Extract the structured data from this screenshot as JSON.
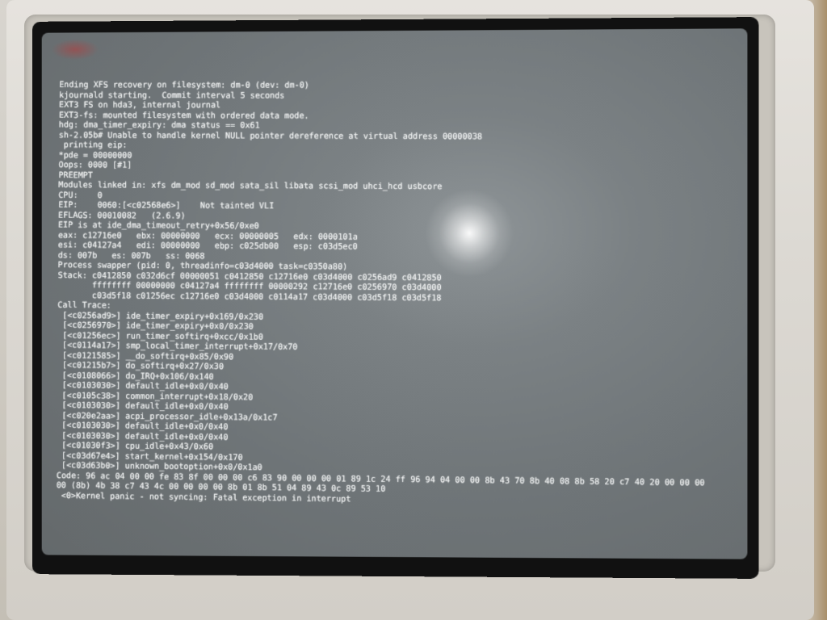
{
  "console": {
    "lines": [
      "Ending XFS recovery on filesystem: dm-0 (dev: dm-0)",
      "kjournald starting.  Commit interval 5 seconds",
      "EXT3 FS on hda3, internal journal",
      "EXT3-fs: mounted filesystem with ordered data mode.",
      "hdg: dma_timer_expiry: dma status == 0x61",
      "sh-2.05b# Unable to handle kernel NULL pointer dereference at virtual address 00000038",
      " printing eip:",
      "*pde = 00000000",
      "Oops: 0000 [#1]",
      "PREEMPT",
      "Modules linked in: xfs dm_mod sd_mod sata_sil libata scsi_mod uhci_hcd usbcore",
      "CPU:    0",
      "EIP:    0060:[<c02568e6>]    Not tainted VLI",
      "EFLAGS: 00010082   (2.6.9)",
      "EIP is at ide_dma_timeout_retry+0x56/0xe0",
      "eax: c12716e0   ebx: 00000000   ecx: 00000005   edx: 0000101a",
      "esi: c04127a4   edi: 00000000   ebp: c025db00   esp: c03d5ec0",
      "ds: 007b   es: 007b   ss: 0068",
      "Process swapper (pid: 0, threadinfo=c03d4000 task=c0350a80)",
      "Stack: c0412850 c032d6cf 00000051 c0412850 c12716e0 c03d4000 c0256ad9 c0412850",
      "       ffffffff 00000000 c04127a4 ffffffff 00000292 c12716e0 c0256970 c03d4000",
      "       c03d5f18 c01256ec c12716e0 c03d4000 c0114a17 c03d4000 c03d5f18 c03d5f18",
      "Call Trace:",
      " [<c0256ad9>] ide_timer_expiry+0x169/0x230",
      " [<c0256970>] ide_timer_expiry+0x0/0x230",
      " [<c01256ec>] run_timer_softirq+0xcc/0x1b0",
      " [<c0114a17>] smp_local_timer_interrupt+0x17/0x70",
      " [<c0121585>] __do_softirq+0x85/0x90",
      " [<c01215b7>] do_softirq+0x27/0x30",
      " [<c0108066>] do_IRQ+0x106/0x140",
      " [<c0103030>] default_idle+0x0/0x40",
      " [<c0105c38>] common_interrupt+0x18/0x20",
      " [<c0103030>] default_idle+0x0/0x40",
      " [<c020e2aa>] acpi_processor_idle+0x13a/0x1c7",
      " [<c0103030>] default_idle+0x0/0x40",
      " [<c0103030>] default_idle+0x0/0x40",
      " [<c01030f3>] cpu_idle+0x43/0x60",
      " [<c03d67e4>] start_kernel+0x154/0x170",
      " [<c03d63b0>] unknown_bootoption+0x0/0x1a0",
      "Code: 96 ac 04 00 00 fe 83 8f 00 00 00 c6 83 90 00 00 00 01 89 1c 24 ff 96 94 04 00 00 8b 43 70 8b 40 08 8b 58 20 c7 40 20 00 00 00",
      "00 (8b) 4b 38 c7 43 4c 00 00 00 00 8b 01 8b 51 04 89 43 0c 89 53 10",
      " <0>Kernel panic - not syncing: Fatal exception in interrupt"
    ]
  }
}
